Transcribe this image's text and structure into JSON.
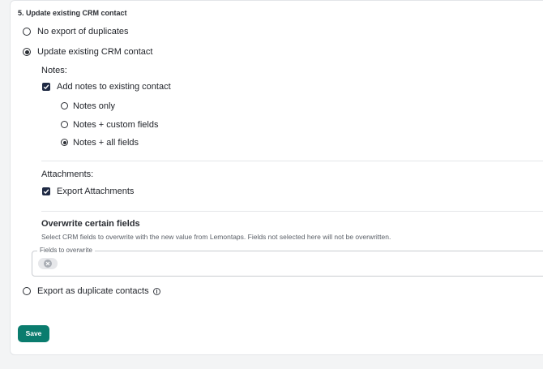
{
  "section_title": "5. Update existing CRM contact",
  "options": {
    "no_export": {
      "label": "No export of duplicates",
      "checked": false
    },
    "update_existing": {
      "label": "Update existing CRM contact",
      "checked": true
    },
    "export_duplicates": {
      "label": "Export as duplicate contacts",
      "checked": false
    }
  },
  "notes": {
    "heading": "Notes:",
    "add_notes": {
      "label": "Add notes to existing contact",
      "checked": true
    },
    "choices": [
      {
        "label": "Notes only",
        "checked": false
      },
      {
        "label": "Notes + custom fields",
        "checked": false
      },
      {
        "label": "Notes + all fields",
        "checked": true
      }
    ]
  },
  "attachments": {
    "heading": "Attachments:",
    "export_attachments": {
      "label": "Export Attachments",
      "checked": true
    }
  },
  "overwrite": {
    "heading": "Overwrite certain fields",
    "description": "Select CRM fields to overwrite with the new value from Lemontaps. Fields not selected here will not be overwritten.",
    "field_label": "Fields to overwrite"
  },
  "icons": {
    "info": "info-icon",
    "chip_clear": "close-circle-icon",
    "check": "check-icon"
  },
  "save_label": "Save",
  "colors": {
    "accent": "#0a7c6e",
    "checkbox": "#1f2a44",
    "background": "#f3f4f5"
  }
}
